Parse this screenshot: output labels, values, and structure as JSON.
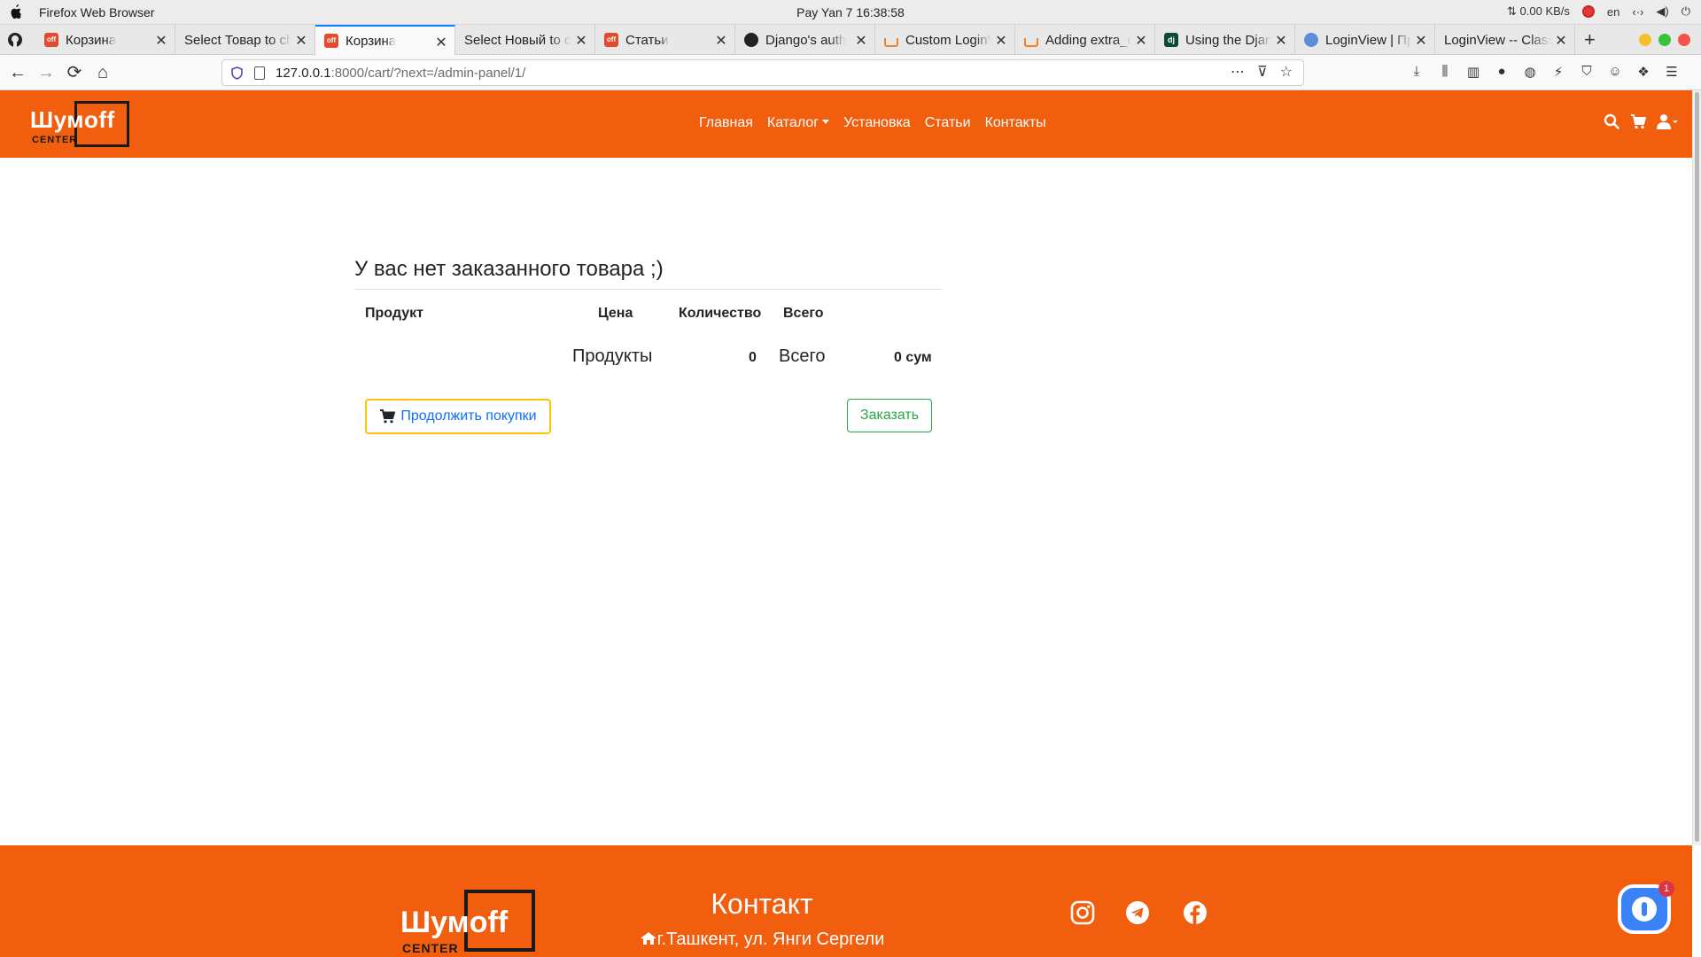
{
  "os": {
    "app_name": "Firefox Web Browser",
    "clock": "Pay Yan 7  16:38:58",
    "net_speed": "⇅ 0.00 KB/s",
    "lang": "en"
  },
  "tabs": [
    {
      "title": "Корзина",
      "favicon": "off-icon",
      "active": false
    },
    {
      "title": "Select Товар to change",
      "favicon": "none",
      "active": false
    },
    {
      "title": "Корзина",
      "favicon": "off-icon",
      "active": true
    },
    {
      "title": "Select Новый to change",
      "favicon": "none",
      "active": false
    },
    {
      "title": "Статьи",
      "favicon": "off-icon",
      "active": false
    },
    {
      "title": "Django's auth",
      "favicon": "github-icon",
      "active": false
    },
    {
      "title": "Custom LoginView",
      "favicon": "stackoverflow-icon",
      "active": false
    },
    {
      "title": "Adding extra_context",
      "favicon": "stackoverflow-icon",
      "active": false
    },
    {
      "title": "Using the Django",
      "favicon": "django-icon",
      "active": false
    },
    {
      "title": "LoginView | Пр",
      "favicon": "ccbv-icon",
      "active": false
    },
    {
      "title": "LoginView -- Class",
      "favicon": "none",
      "active": false
    }
  ],
  "url": {
    "host": "127.0.0.1",
    "rest": ":8000/cart/?next=/admin-panel/1/"
  },
  "site": {
    "logo_text": "Шумoff",
    "logo_sub": "CENTER",
    "nav": [
      "Главная",
      "Каталог",
      "Установка",
      "Статьи",
      "Контакты"
    ]
  },
  "cart": {
    "title": "У вас нет заказанного товара ;)",
    "columns": [
      "Продукт",
      "Цена",
      "Количество",
      "Всего"
    ],
    "summary": {
      "products_label": "Продукты",
      "products_count": "0",
      "total_label": "Всего",
      "total_value": "0 сум"
    },
    "continue_label": "Продолжить покупки",
    "order_label": "Заказать"
  },
  "footer": {
    "contact_title": "Контакт",
    "address": "г.Ташкент, ул. Янги Сергели",
    "social": [
      "instagram-icon",
      "telegram-icon",
      "facebook-icon"
    ]
  },
  "chat": {
    "badge": "1"
  },
  "colors": {
    "brand": "#f15e0e",
    "link": "#0d6efd",
    "success": "#28a745",
    "warning": "#ffc107"
  }
}
